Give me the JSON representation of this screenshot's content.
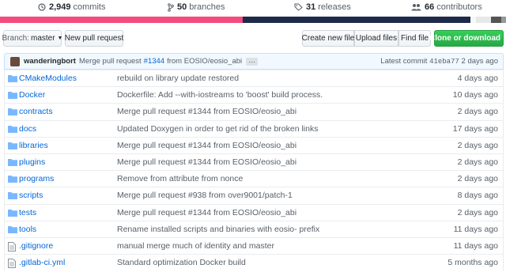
{
  "stats": {
    "commits": {
      "count": "2,949",
      "label": "commits",
      "icon": "history-icon"
    },
    "branches": {
      "count": "50",
      "label": "branches",
      "icon": "branch-icon"
    },
    "releases": {
      "count": "31",
      "label": "releases",
      "icon": "tag-icon"
    },
    "contributors": {
      "count": "66",
      "label": "contributors",
      "icon": "people-icon"
    }
  },
  "language_bar": [
    {
      "color": "#f34b7d",
      "share": 0.48
    },
    {
      "color": "#1e2a4a",
      "share": 0.45
    },
    {
      "color": "#f6f8fa",
      "share": 0.01
    },
    {
      "color": "#e8e8e8",
      "share": 0.03
    },
    {
      "color": "#555555",
      "share": 0.02
    },
    {
      "color": "#999999",
      "share": 0.01
    }
  ],
  "toolbar": {
    "branch_label": "Branch:",
    "branch_value": "master",
    "new_pr": "New pull request",
    "create_file": "Create new file",
    "upload_files": "Upload files",
    "find_file": "Find file",
    "clone": "Clone or download"
  },
  "latest_commit": {
    "author": "wanderingbort",
    "message_prefix": "Merge pull request",
    "pr": "#1344",
    "message_suffix": "from EOSIO/eosio_abi",
    "more": "…",
    "latest_label": "Latest commit",
    "sha": "41eba77",
    "when": "2 days ago"
  },
  "files": [
    {
      "type": "dir",
      "name": "CMakeModules",
      "message": "rebuild on library update restored",
      "age": "4 days ago"
    },
    {
      "type": "dir",
      "name": "Docker",
      "message": "Dockerfile: Add --with-iostreams to 'boost' build process.",
      "age": "10 days ago"
    },
    {
      "type": "dir",
      "name": "contracts",
      "message": "Merge pull request #1344 from EOSIO/eosio_abi",
      "age": "2 days ago"
    },
    {
      "type": "dir",
      "name": "docs",
      "message": "Updated Doxygen in order to get rid of the broken links",
      "age": "17 days ago"
    },
    {
      "type": "dir",
      "name": "libraries",
      "message": "Merge pull request #1344 from EOSIO/eosio_abi",
      "age": "2 days ago"
    },
    {
      "type": "dir",
      "name": "plugins",
      "message": "Merge pull request #1344 from EOSIO/eosio_abi",
      "age": "2 days ago"
    },
    {
      "type": "dir",
      "name": "programs",
      "message": "Remove from attribute from nonce",
      "age": "2 days ago"
    },
    {
      "type": "dir",
      "name": "scripts",
      "message": "Merge pull request #938 from over9001/patch-1",
      "age": "8 days ago"
    },
    {
      "type": "dir",
      "name": "tests",
      "message": "Merge pull request #1344 from EOSIO/eosio_abi",
      "age": "2 days ago"
    },
    {
      "type": "dir",
      "name": "tools",
      "message": "Rename installed scripts and binaries with eosio- prefix",
      "age": "11 days ago"
    },
    {
      "type": "file",
      "name": ".gitignore",
      "message": "manual merge much of identity and master",
      "age": "11 days ago"
    },
    {
      "type": "file",
      "name": ".gitlab-ci.yml",
      "message": "Standard optimization Docker build",
      "age": "5 months ago"
    }
  ]
}
